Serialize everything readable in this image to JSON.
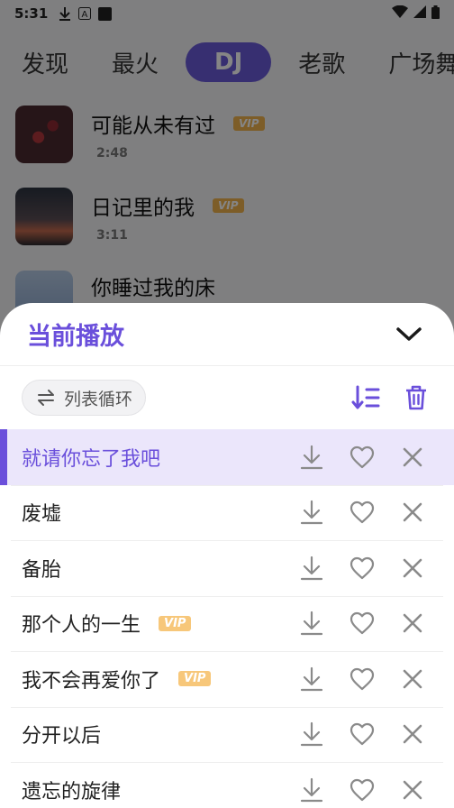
{
  "status_bar": {
    "time": "5:31",
    "icons": [
      "download-icon",
      "notification-icon",
      "square-icon"
    ],
    "right_icons": [
      "wifi-icon",
      "signal-icon",
      "battery-icon"
    ]
  },
  "tabs": [
    {
      "label": "发现",
      "active": false
    },
    {
      "label": "最火",
      "active": false
    },
    {
      "label": "DJ",
      "active": true
    },
    {
      "label": "老歌",
      "active": false
    },
    {
      "label": "广场舞",
      "active": false
    }
  ],
  "background_songs": [
    {
      "title": "可能从未有过",
      "vip": "VIP",
      "duration": "2:48",
      "cover_color": "#4a2a2e"
    },
    {
      "title": "日记里的我",
      "vip": "VIP",
      "duration": "3:11",
      "cover_color": "#2c3440"
    },
    {
      "title": "你睡过我的床",
      "vip": "",
      "duration": "",
      "cover_color": "#9fb7d8"
    }
  ],
  "sheet": {
    "title": "当前播放",
    "play_mode": "列表循环",
    "accent": "#6a4fdb",
    "items": [
      {
        "title": "就请你忘了我吧",
        "vip": "",
        "current": true
      },
      {
        "title": "废墟",
        "vip": "",
        "current": false
      },
      {
        "title": "备胎",
        "vip": "",
        "current": false
      },
      {
        "title": "那个人的一生",
        "vip": "VIP",
        "current": false
      },
      {
        "title": "我不会再爱你了",
        "vip": "VIP",
        "current": false
      },
      {
        "title": "分开以后",
        "vip": "",
        "current": false
      },
      {
        "title": "遗忘的旋律",
        "vip": "",
        "current": false
      }
    ]
  }
}
